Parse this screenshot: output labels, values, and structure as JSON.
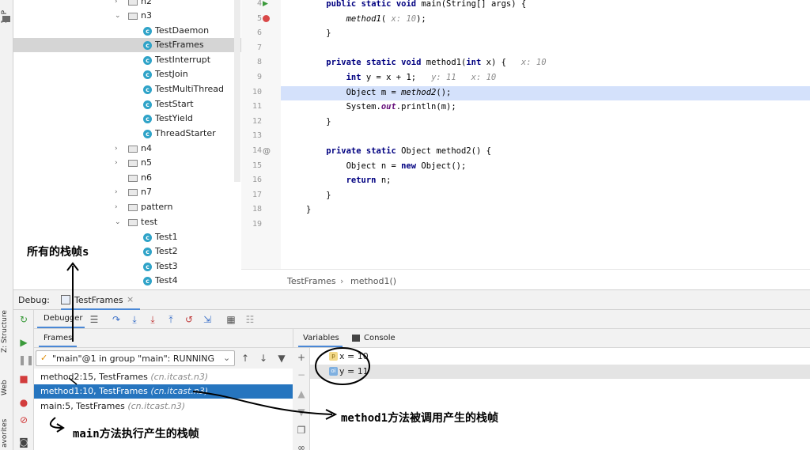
{
  "left_strip": {
    "project_tab": "1: P",
    "structure_tab": "Z: Structure",
    "web_tab": "Web",
    "favorites_tab": "avorites"
  },
  "tree": {
    "items": [
      {
        "label": "n2",
        "type": "folder",
        "expanded": false,
        "depth": 0
      },
      {
        "label": "n3",
        "type": "folder",
        "expanded": true,
        "depth": 0
      },
      {
        "label": "TestDaemon",
        "type": "class",
        "depth": 1
      },
      {
        "label": "TestFrames",
        "type": "class",
        "depth": 1,
        "selected": true
      },
      {
        "label": "TestInterrupt",
        "type": "class",
        "depth": 1
      },
      {
        "label": "TestJoin",
        "type": "class",
        "depth": 1
      },
      {
        "label": "TestMultiThread",
        "type": "class",
        "depth": 1
      },
      {
        "label": "TestStart",
        "type": "class",
        "depth": 1
      },
      {
        "label": "TestYield",
        "type": "class",
        "depth": 1
      },
      {
        "label": "ThreadStarter",
        "type": "class",
        "depth": 1
      },
      {
        "label": "n4",
        "type": "folder",
        "expanded": false,
        "depth": 0
      },
      {
        "label": "n5",
        "type": "folder",
        "expanded": false,
        "depth": 0
      },
      {
        "label": "n6",
        "type": "folder",
        "expanded": null,
        "depth": 0
      },
      {
        "label": "n7",
        "type": "folder",
        "expanded": false,
        "depth": 0
      },
      {
        "label": "pattern",
        "type": "folder",
        "expanded": false,
        "depth": 0
      },
      {
        "label": "test",
        "type": "folder",
        "expanded": true,
        "depth": 0
      },
      {
        "label": "Test1",
        "type": "class",
        "depth": 1
      },
      {
        "label": "Test2",
        "type": "class",
        "depth": 1
      },
      {
        "label": "Test3",
        "type": "class",
        "depth": 1
      },
      {
        "label": "Test4",
        "type": "class",
        "depth": 1
      }
    ]
  },
  "editor": {
    "lines": [
      {
        "n": "4",
        "code": "    public static void main(String[] args) {"
      },
      {
        "n": "5",
        "code": "        method1( x: 10);"
      },
      {
        "n": "6",
        "code": "    }"
      },
      {
        "n": "7",
        "code": ""
      },
      {
        "n": "8",
        "code": "    private static void method1(int x) {   x: 10"
      },
      {
        "n": "9",
        "code": "        int y = x + 1;   y: 11   x: 10"
      },
      {
        "n": "10",
        "code": "        Object m = method2();"
      },
      {
        "n": "11",
        "code": "        System.out.println(m);"
      },
      {
        "n": "12",
        "code": "    }"
      },
      {
        "n": "13",
        "code": ""
      },
      {
        "n": "14",
        "code": "    private static Object method2() {"
      },
      {
        "n": "15",
        "code": "        Object n = new Object();"
      },
      {
        "n": "16",
        "code": "        return n;"
      },
      {
        "n": "17",
        "code": "    }"
      },
      {
        "n": "18",
        "code": "}"
      },
      {
        "n": "19",
        "code": ""
      }
    ],
    "current_line": "10",
    "breadcrumb": {
      "file": "TestFrames",
      "sep": "›",
      "method": "method1()"
    }
  },
  "debug": {
    "title": "Debug:",
    "config_tab": "TestFrames",
    "close_glyph": "×",
    "debugger_tab": "Debugger",
    "frames_tab": "Frames",
    "thread_select": "\"main\"@1 in group \"main\": RUNNING",
    "frames": [
      {
        "method": "method2:15, TestFrames",
        "pkg": "(cn.itcast.n3)",
        "selected": false
      },
      {
        "method": "method1:10, TestFrames",
        "pkg": "(cn.itcast.n3)",
        "selected": true
      },
      {
        "method": "main:5, TestFrames",
        "pkg": "(cn.itcast.n3)",
        "selected": false
      }
    ],
    "variables_tab": "Variables",
    "console_tab": "Console",
    "variables": [
      {
        "badge": "p",
        "text": "x = 10",
        "selected": false
      },
      {
        "badge": "oi",
        "text": "y = 11",
        "selected": true
      }
    ]
  },
  "annotations": {
    "all_frames": "所有的栈帧s",
    "main_frame": "main方法执行产生的栈帧",
    "method1_frame": "method1方法被调用产生的栈帧"
  },
  "colors": {
    "selection_blue": "#2675bf",
    "current_line": "#d4e1fb",
    "keyword": "#000080",
    "class_icon": "#2fa3c8"
  }
}
